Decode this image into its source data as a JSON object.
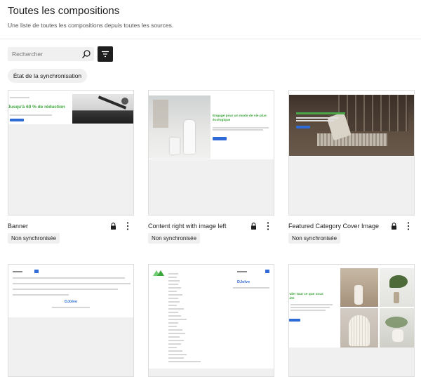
{
  "header": {
    "title": "Toutes les compositions",
    "subtitle": "Une liste de toutes les compositions depuis toutes les sources."
  },
  "search": {
    "placeholder": "Rechercher"
  },
  "sync_filter": {
    "label": "État de la synchronisation"
  },
  "icons": {
    "search": "search-icon",
    "filter": "filter-icon",
    "lock": "lock-icon",
    "more": "more-vertical-icon"
  },
  "colors": {
    "accent": "#1e1e1e",
    "preview_green": "#3ba63b",
    "preview_blue": "#2e6bd6",
    "badge_bg": "#f0f0f0"
  },
  "patterns": [
    {
      "name": "Banner",
      "status": "Non synchronisée",
      "preview_heading": "Jusqu'à 60 % de réduction"
    },
    {
      "name": "Content right with image left",
      "status": "Non synchronisée",
      "preview_heading": "Engagé pour un mode de vie plus écologique"
    },
    {
      "name": "Featured Category Cover Image",
      "status": "Non synchronisée"
    },
    {
      "name": "",
      "status": "",
      "preview_heading": "DJolve"
    },
    {
      "name": "",
      "status": "",
      "preview_heading": "DJolve"
    },
    {
      "name": "",
      "status": "",
      "preview_heading": "nder tout ce que vous\nuite"
    }
  ]
}
